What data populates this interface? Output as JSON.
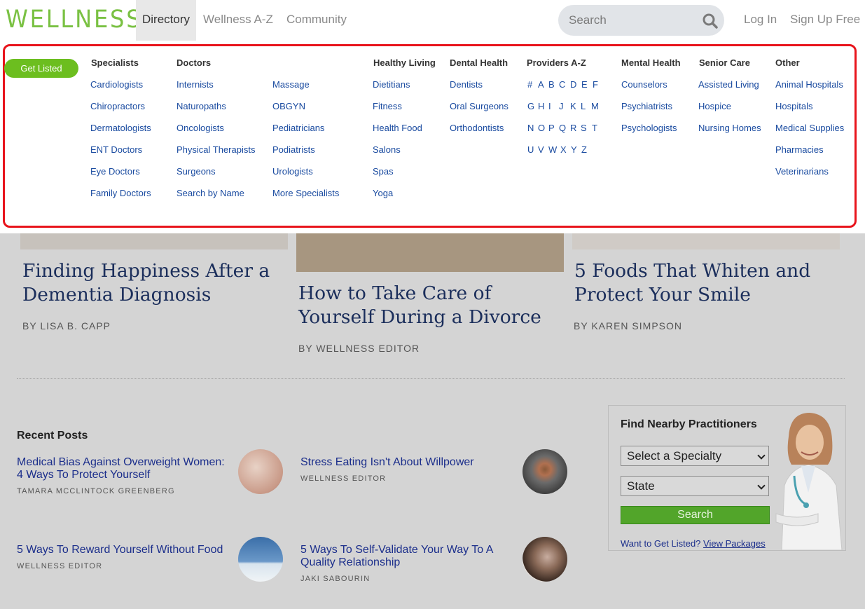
{
  "header": {
    "logo": "WELLNESS",
    "nav": [
      "Directory",
      "Wellness A-Z",
      "Community"
    ],
    "search_placeholder": "Search",
    "login": "Log In",
    "signup": "Sign Up Free"
  },
  "menu": {
    "get_listed": "Get Listed",
    "columns": [
      {
        "heading": "Specialists",
        "links": [
          "Cardiologists",
          "Chiropractors",
          "Dermatologists",
          "ENT Doctors",
          "Eye Doctors",
          "Family Doctors"
        ]
      },
      {
        "heading": "Doctors",
        "links": [
          "Internists",
          "Naturopaths",
          "Oncologists",
          "Physical Therapists",
          "Surgeons",
          "Search by Name"
        ]
      },
      {
        "heading": "",
        "links": [
          "Massage",
          "OBGYN",
          "Pediatricians",
          "Podiatrists",
          "Urologists",
          "More Specialists"
        ]
      },
      {
        "heading": "Healthy Living",
        "links": [
          "Dietitians",
          "Fitness",
          "Health Food",
          "Salons",
          "Spas",
          "Yoga"
        ]
      },
      {
        "heading": "Dental Health",
        "links": [
          "Dentists",
          "Oral Surgeons",
          "Orthodontists"
        ]
      },
      {
        "heading": "Providers A-Z",
        "rows": [
          [
            "#",
            "A",
            "B",
            "C",
            "D",
            "E",
            "F"
          ],
          [
            "G",
            "H",
            "I",
            "J",
            "K",
            "L",
            "M"
          ],
          [
            "N",
            "O",
            "P",
            "Q",
            "R",
            "S",
            "T"
          ],
          [
            "U",
            "V",
            "W",
            "X",
            "Y",
            "Z"
          ]
        ]
      },
      {
        "heading": "Mental Health",
        "links": [
          "Counselors",
          "Psychiatrists",
          "Psychologists"
        ]
      },
      {
        "heading": "Senior Care",
        "links": [
          "Assisted Living",
          "Hospice",
          "Nursing Homes"
        ]
      },
      {
        "heading": "Other",
        "links": [
          "Animal Hospitals",
          "Hospitals",
          "Medical Supplies",
          "Pharmacies",
          "Veterinarians"
        ]
      }
    ]
  },
  "articles": [
    {
      "title": "Finding Happiness After a Dementia Diagnosis",
      "author": "BY LISA B. CAPP"
    },
    {
      "title": "How to Take Care of Yourself During a Divorce",
      "author": "BY WELLNESS EDITOR"
    },
    {
      "title": "5 Foods That Whiten and Protect Your Smile",
      "author": "BY KAREN SIMPSON"
    }
  ],
  "recent": {
    "heading": "Recent Posts",
    "posts": [
      {
        "title": "Medical Bias Against Overweight Women: 4 Ways To Protect Yourself",
        "author": "TAMARA MCCLINTOCK GREENBERG"
      },
      {
        "title": "Stress Eating Isn't About Willpower",
        "author": "WELLNESS EDITOR"
      },
      {
        "title": "5 Ways To Reward Yourself Without Food",
        "author": "WELLNESS EDITOR"
      },
      {
        "title": "5 Ways To Self-Validate Your Way To A Quality Relationship",
        "author": "JAKI SABOURIN"
      }
    ]
  },
  "finder": {
    "title": "Find Nearby Practitioners",
    "specialty": "Select a Specialty",
    "state": "State",
    "search": "Search",
    "footer_text": "Want to Get Listed?",
    "footer_link": "View Packages"
  },
  "colors": {
    "brand_green": "#7ac143",
    "link_blue": "#1a4ba0",
    "highlight_red": "#e8141c",
    "button_green": "#52a52a"
  }
}
